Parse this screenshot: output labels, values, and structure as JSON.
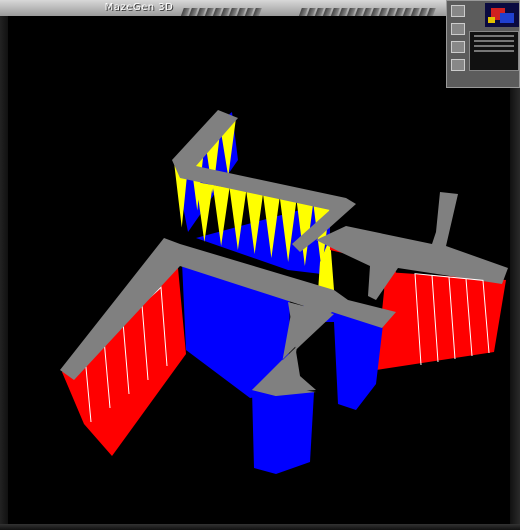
{
  "window": {
    "title": "MazeGen 3D"
  },
  "colors": {
    "background": "#000000",
    "wall_top": "#808080",
    "wall_red": "#ff0000",
    "wall_blue": "#0000ff",
    "wall_yellow": "#ffff00"
  },
  "icons": {
    "title_bar_decoration": "hatched-lines-icon",
    "thumbnail": "maze-preview-icon"
  }
}
